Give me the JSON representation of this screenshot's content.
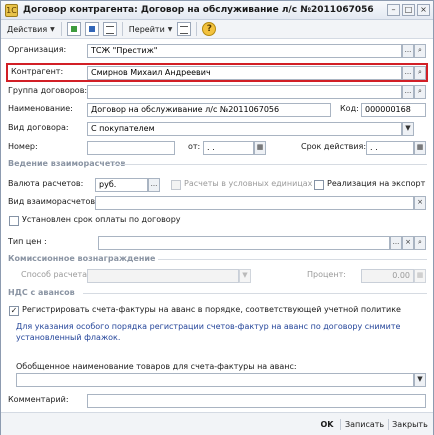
{
  "window": {
    "title": "Договор контрагента: Договор на обслуживание л/с №2011067056",
    "title_icon": "1С"
  },
  "toolbar": {
    "actions_label": "Действия",
    "goto_label": "Перейти",
    "help_glyph": "?"
  },
  "form": {
    "org_label": "Организация:",
    "org_value": "ТСЖ \"Престиж\"",
    "contractor_label": "Контрагент:",
    "contractor_value": "Смирнов Михаил Андреевич",
    "group_label": "Группа договоров:",
    "group_value": "",
    "name_label": "Наименование:",
    "name_value": "Договор на обслуживание л/с №2011067056",
    "code_label": "Код:",
    "code_value": "000000168",
    "type_label": "Вид договора:",
    "type_value": "С покупателем",
    "number_label": "Номер:",
    "number_value": "",
    "from_label": "от:",
    "from_value": ".  .",
    "term_label": "Срок действия:",
    "term_value": ".  ."
  },
  "settlements": {
    "header": "Ведение взаиморасчетов",
    "currency_label": "Валюта расчетов:",
    "currency_value": "руб.",
    "conv_units_label": "Расчеты в условных единицах",
    "export_label": "Реализация на экспорт",
    "mode_label": "Вид взаиморасчетов:",
    "mode_value": "",
    "payterm_label": "Установлен срок оплаты по договору",
    "price_type_label": "Тип цен :",
    "price_type_value": ""
  },
  "commission": {
    "header": "Комиссионное вознаграждение",
    "method_label": "Способ расчета:",
    "method_value": "",
    "percent_label": "Процент:",
    "percent_value": "0.00"
  },
  "vat": {
    "header": "НДС с авансов",
    "register_label": "Регистрировать счета-фактуры на аванс в порядке, соответствующей учетной политике",
    "register_checked": "✓",
    "note": "Для указания особого порядка регистрации счетов-фактур на аванс по договору снимите установленный флажок.",
    "goods_name_label": "Обобщенное наименование товаров для счета-фактуры на аванс:",
    "goods_name_value": ""
  },
  "comment": {
    "label": "Комментарий:",
    "value": ""
  },
  "footer": {
    "ok_label": "OK",
    "save_label": "Записать",
    "close_label": "Закрыть"
  },
  "colors": {
    "highlight": "#d21f26",
    "section_header": "#8a94a3",
    "note_text": "#24459a"
  }
}
